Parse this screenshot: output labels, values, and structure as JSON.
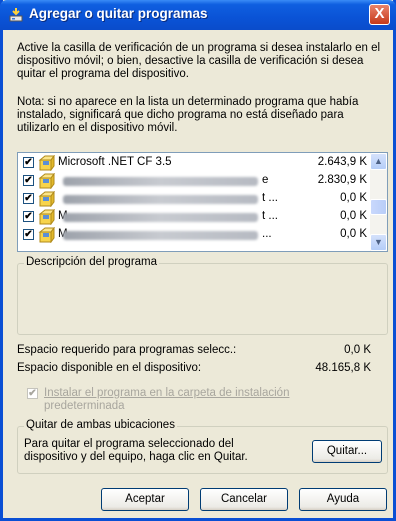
{
  "window": {
    "title": "Agregar o quitar programas",
    "close_label": "X"
  },
  "instructions": "Active la casilla de verificación de un programa si desea instalarlo en el dispositivo móvil; o bien, desactive la casilla de verificación si desea quitar el programa del dispositivo.",
  "note": "Nota: si no aparece en la lista un determinado programa que había instalado, significará que dicho programa no está diseñado para utilizarlo en el dispositivo móvil.",
  "programs": [
    {
      "name": "Microsoft .NET CF 3.5",
      "suffix": "",
      "size": "2.643,9 K",
      "checked": "✔",
      "blurred": false
    },
    {
      "name": "",
      "suffix": "e",
      "size": "2.830,9 K",
      "checked": "✔",
      "blurred": true
    },
    {
      "name": "",
      "suffix": "t ...",
      "size": "0,0 K",
      "checked": "✔",
      "blurred": true
    },
    {
      "name": "M",
      "suffix": "t ...",
      "size": "0,0 K",
      "checked": "✔",
      "blurred": true
    },
    {
      "name": "M",
      "suffix": "...",
      "size": "0,0 K",
      "checked": "✔",
      "blurred": true
    }
  ],
  "description": {
    "legend": "Descripción del programa"
  },
  "space": {
    "required_label": "Espacio requerido para programas selecc.:",
    "required_value": "0,0 K",
    "available_label": "Espacio disponible en el dispositivo:",
    "available_value": "48.165,8 K"
  },
  "default_install": {
    "label_line1": "Instalar el programa en la carpeta de instalación",
    "label_line2": "predeterminada",
    "checked": "✔"
  },
  "remove_group": {
    "legend": "Quitar de ambas ubicaciones",
    "text_line1": "Para quitar el programa seleccionado del",
    "text_line2": "dispositivo y del equipo, haga clic en Quitar.",
    "button": "Quitar..."
  },
  "footer": {
    "ok": "Aceptar",
    "cancel": "Cancelar",
    "help": "Ayuda"
  }
}
